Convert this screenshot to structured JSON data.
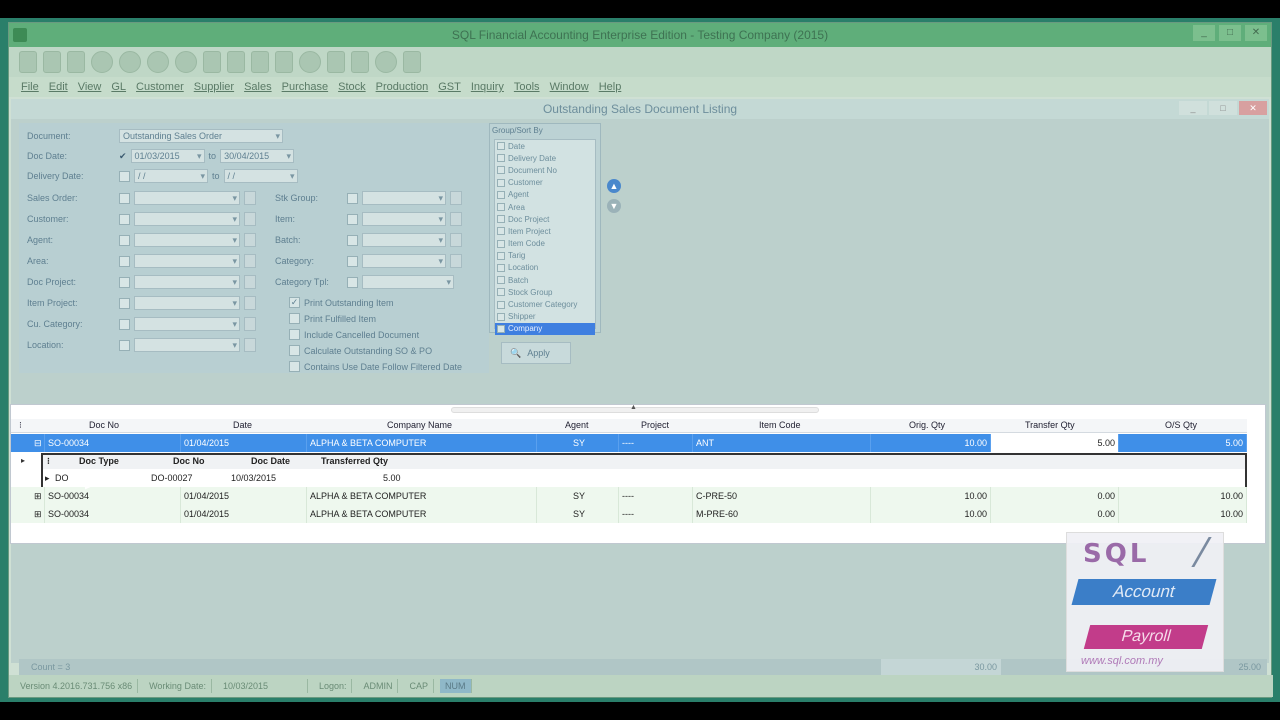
{
  "window": {
    "title": "SQL Financial Accounting Enterprise Edition - Testing Company (2015)",
    "buttons": [
      "_",
      "□",
      "✕"
    ]
  },
  "menu": [
    "File",
    "Edit",
    "View",
    "GL",
    "Customer",
    "Supplier",
    "Sales",
    "Purchase",
    "Stock",
    "Production",
    "GST",
    "Inquiry",
    "Tools",
    "Window",
    "Help"
  ],
  "form": {
    "title": "Outstanding Sales Document Listing",
    "document_label": "Document:",
    "document_value": "Outstanding Sales Order",
    "docdate_label": "Doc Date:",
    "docdate_from": "01/03/2015",
    "docdate_to_label": "to",
    "docdate_to": "30/04/2015",
    "deliverydate_label": "Delivery Date:",
    "deliverydate_from": " / / ",
    "deliverydate_to": " / / ",
    "left_filters": [
      "Sales Order:",
      "Customer:",
      "Agent:",
      "Area:",
      "Doc Project:",
      "Item Project:",
      "Cu. Category:",
      "Location:"
    ],
    "right_filters": [
      "Stk Group:",
      "Item:",
      "Batch:",
      "Category:",
      "Category Tpl:"
    ],
    "options": [
      {
        "label": "Print Outstanding Item",
        "checked": true
      },
      {
        "label": "Print Fulfilled Item",
        "checked": false
      },
      {
        "label": "Include Cancelled Document",
        "checked": false
      },
      {
        "label": "Calculate Outstanding SO & PO",
        "checked": false
      },
      {
        "label": "Contains Use Date Follow Filtered Date",
        "checked": false
      }
    ],
    "groupby_title": "Group/Sort By",
    "groupby_items": [
      "Date",
      "Delivery Date",
      "Document No",
      "Customer",
      "Agent",
      "Area",
      "Doc Project",
      "Item Project",
      "Item Code",
      "Tarig",
      "Location",
      "Batch",
      "Stock Group",
      "Customer Category",
      "Shipper",
      "Company"
    ],
    "apply_label": "Apply"
  },
  "grid": {
    "headers": [
      "Doc No",
      "Date",
      "Company Name",
      "Agent",
      "Project",
      "Item Code",
      "Orig. Qty",
      "Transfer Qty",
      "O/S Qty"
    ],
    "rows": [
      {
        "docno": "SO-00034",
        "date": "01/04/2015",
        "company": "ALPHA & BETA COMPUTER",
        "agent": "SY",
        "project": "----",
        "item": "ANT",
        "orig": "10.00",
        "transfer": "5.00",
        "os": "5.00"
      },
      {
        "docno": "SO-00034",
        "date": "01/04/2015",
        "company": "ALPHA & BETA COMPUTER",
        "agent": "SY",
        "project": "----",
        "item": "C-PRE-50",
        "orig": "10.00",
        "transfer": "0.00",
        "os": "10.00"
      },
      {
        "docno": "SO-00034",
        "date": "01/04/2015",
        "company": "ALPHA & BETA COMPUTER",
        "agent": "SY",
        "project": "----",
        "item": "M-PRE-60",
        "orig": "10.00",
        "transfer": "0.00",
        "os": "10.00"
      }
    ],
    "detail_headers": [
      "Doc Type",
      "Doc No",
      "Doc Date",
      "Transferred Qty"
    ],
    "detail_row": {
      "type": "DO",
      "docno": "DO-00027",
      "date": "10/03/2015",
      "qty": "5.00"
    }
  },
  "footer": {
    "count": "Count = 3",
    "total": "30.00",
    "total2": "25.00"
  },
  "status": {
    "version": "Version 4.2016.731.756 x86",
    "working_date_label": "Working Date:",
    "working_date": "10/03/2015",
    "login_label": "Logon:",
    "user": "ADMIN",
    "caps": "CAP",
    "num": "NUM"
  },
  "logo": {
    "sql": "SQL",
    "account": "Account",
    "payroll": "Payroll",
    "url": "www.sql.com.my"
  }
}
